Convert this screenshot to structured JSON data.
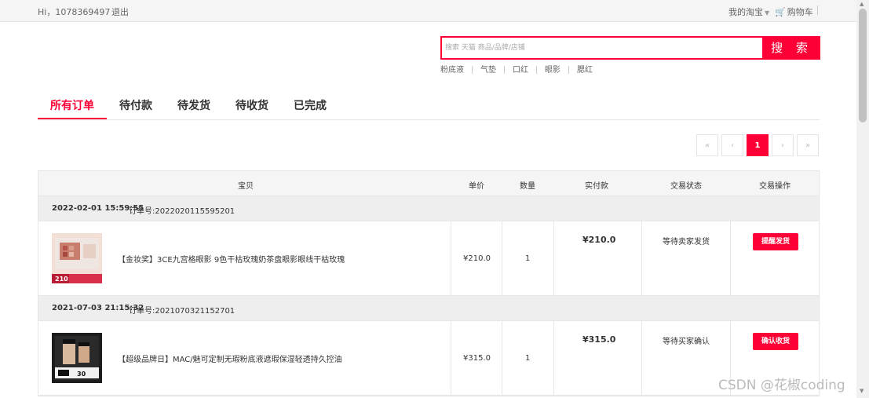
{
  "topbar": {
    "greeting": "Hi，1078369497",
    "logout": "退出",
    "my_taobao": "我的淘宝",
    "cart": "购物车"
  },
  "search": {
    "placeholder": "搜索 天猫 商品/品牌/店铺",
    "button": "搜 索",
    "hot": [
      "粉底液",
      "气垫",
      "口红",
      "眼影",
      "腮红"
    ]
  },
  "tabs": [
    {
      "label": "所有订单",
      "active": true
    },
    {
      "label": "待付款",
      "active": false
    },
    {
      "label": "待发货",
      "active": false
    },
    {
      "label": "待收货",
      "active": false
    },
    {
      "label": "已完成",
      "active": false
    }
  ],
  "pagination": {
    "first": "«",
    "prev": "‹",
    "current": "1",
    "next": "›",
    "last": "»"
  },
  "table_head": {
    "item": "宝贝",
    "price": "单价",
    "qty": "数量",
    "paid": "实付款",
    "status": "交易状态",
    "action": "交易操作"
  },
  "orders": [
    {
      "date": "2022-02-01 15:59:55",
      "order_no": "订单号:2022020115595201",
      "title": "【金妆奖】3CE九宫格眼影 9色干枯玫瑰奶茶盘眼影眼线干枯玫瑰",
      "price": "¥210.0",
      "qty": "1",
      "paid": "¥210.0",
      "status": "等待卖家发货",
      "action": "提醒发货",
      "thumb_price": "210"
    },
    {
      "date": "2021-07-03 21:15:32",
      "order_no": "订单号:2021070321152701",
      "title": "【超级品牌日】MAC/魅可定制无瑕粉底液遮瑕保湿轻透持久控油",
      "price": "¥315.0",
      "qty": "1",
      "paid": "¥315.0",
      "status": "等待买家确认",
      "action": "确认收货",
      "thumb_price": "30"
    }
  ],
  "watermark": "CSDN @花椒coding",
  "colors": {
    "accent": "#ff0036",
    "header_bg": "#f5f5f5",
    "border": "#e6e6e6"
  }
}
